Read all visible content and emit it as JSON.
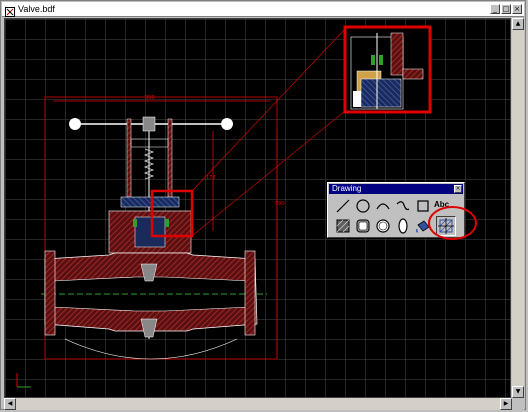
{
  "window": {
    "title": "Valve.bdf"
  },
  "canvas": {
    "dimensions": {
      "width_label": "350",
      "height_label": "590",
      "inner_label": "178"
    }
  },
  "palette": {
    "title": "Drawing",
    "tools": [
      {
        "id": "line",
        "icon": "line-icon"
      },
      {
        "id": "circle",
        "icon": "circle-icon"
      },
      {
        "id": "arc",
        "icon": "arc-icon"
      },
      {
        "id": "spline",
        "icon": "spline-icon"
      },
      {
        "id": "rectangle",
        "icon": "rectangle-icon"
      },
      {
        "id": "text",
        "icon": "text-icon",
        "label": "Abc"
      },
      {
        "id": "hatch-rectangle",
        "icon": "hatch-rectangle-icon"
      },
      {
        "id": "rounded-rectangle",
        "icon": "rounded-rectangle-icon"
      },
      {
        "id": "filled-circle",
        "icon": "filled-circle-icon"
      },
      {
        "id": "ellipse",
        "icon": "ellipse-icon"
      },
      {
        "id": "fill-bucket",
        "icon": "fill-bucket-icon"
      },
      {
        "id": "hatch-region",
        "icon": "hatch-region-icon",
        "highlighted": true
      }
    ]
  },
  "colors": {
    "canvas": "#000000",
    "grid": "#4a4a4a",
    "outline": "#ffffff",
    "dimension": "#e00000",
    "highlight": "#e00000",
    "palette_title": "#000080"
  }
}
